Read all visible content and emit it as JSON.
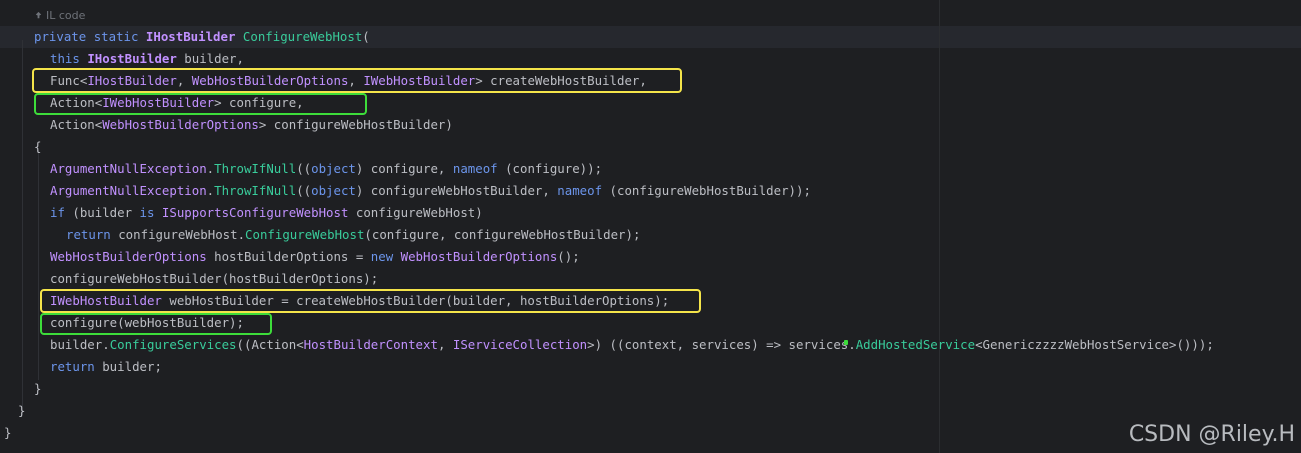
{
  "hint": {
    "label": "IL code",
    "icon": "pin-icon"
  },
  "code_lines": [
    [
      [
        "kw",
        "private"
      ],
      [
        "pn",
        " "
      ],
      [
        "kw",
        "static"
      ],
      [
        "pn",
        " "
      ],
      [
        "tyb",
        "IHostBuilder"
      ],
      [
        "pn",
        " "
      ],
      [
        "fn",
        "ConfigureWebHost"
      ],
      [
        "pn",
        "("
      ]
    ],
    [
      [
        "kw",
        "this"
      ],
      [
        "pn",
        " "
      ],
      [
        "tyb",
        "IHostBuilder"
      ],
      [
        "pn",
        " builder,"
      ]
    ],
    [
      [
        "id",
        "Func<"
      ],
      [
        "ty",
        "IHostBuilder"
      ],
      [
        "pn",
        ", "
      ],
      [
        "ty",
        "WebHostBuilderOptions"
      ],
      [
        "pn",
        ", "
      ],
      [
        "ty",
        "IWebHostBuilder"
      ],
      [
        "pn",
        "> createWebHostBuilder,"
      ]
    ],
    [
      [
        "id",
        "Action<"
      ],
      [
        "ty",
        "IWebHostBuilder"
      ],
      [
        "pn",
        "> configure,"
      ]
    ],
    [
      [
        "id",
        "Action<"
      ],
      [
        "ty",
        "WebHostBuilderOptions"
      ],
      [
        "pn",
        "> configureWebHostBuilder)"
      ]
    ],
    [
      [
        "pn",
        "{"
      ]
    ],
    [
      [
        "ty",
        "ArgumentNullException"
      ],
      [
        "pn",
        "."
      ],
      [
        "fn",
        "ThrowIfNull"
      ],
      [
        "pn",
        "(("
      ],
      [
        "kw",
        "object"
      ],
      [
        "pn",
        ") configure, "
      ],
      [
        "kw",
        "nameof"
      ],
      [
        "pn",
        " (configure));"
      ]
    ],
    [
      [
        "ty",
        "ArgumentNullException"
      ],
      [
        "pn",
        "."
      ],
      [
        "fn",
        "ThrowIfNull"
      ],
      [
        "pn",
        "(("
      ],
      [
        "kw",
        "object"
      ],
      [
        "pn",
        ") configureWebHostBuilder, "
      ],
      [
        "kw",
        "nameof"
      ],
      [
        "pn",
        " (configureWebHostBuilder));"
      ]
    ],
    [
      [
        "kw",
        "if"
      ],
      [
        "pn",
        " (builder "
      ],
      [
        "kw",
        "is"
      ],
      [
        "pn",
        " "
      ],
      [
        "ty",
        "ISupportsConfigureWebHost"
      ],
      [
        "pn",
        " configureWebHost)"
      ]
    ],
    [
      [
        "kw",
        "return"
      ],
      [
        "pn",
        " configureWebHost."
      ],
      [
        "fn",
        "ConfigureWebHost"
      ],
      [
        "pn",
        "(configure, configureWebHostBuilder);"
      ]
    ],
    [
      [
        "ty",
        "WebHostBuilderOptions"
      ],
      [
        "pn",
        " hostBuilderOptions = "
      ],
      [
        "kw",
        "new"
      ],
      [
        "pn",
        " "
      ],
      [
        "ty",
        "WebHostBuilderOptions"
      ],
      [
        "pn",
        "();"
      ]
    ],
    [
      [
        "pn",
        "configureWebHostBuilder(hostBuilderOptions);"
      ]
    ],
    [
      [
        "ty",
        "IWebHostBuilder"
      ],
      [
        "pn",
        " webHostBuilder = createWebHostBuilder(builder, hostBuilderOptions);"
      ]
    ],
    [
      [
        "pn",
        "configure(webHostBuilder);"
      ]
    ],
    [
      [
        "pn",
        "builder."
      ],
      [
        "fn",
        "ConfigureServices"
      ],
      [
        "pn",
        "(("
      ],
      [
        "id",
        "Action<"
      ],
      [
        "ty",
        "HostBuilderContext"
      ],
      [
        "pn",
        ", "
      ],
      [
        "ty",
        "IServiceCollection"
      ],
      [
        "pn",
        ">) ((context, services) => services."
      ],
      [
        "fn",
        "AddHostedService"
      ],
      [
        "pn",
        "<GenericzzzzWebHostService>()));"
      ]
    ],
    [
      [
        "kw",
        "return"
      ],
      [
        "pn",
        " builder;"
      ]
    ],
    [
      [
        "pn",
        "}"
      ]
    ],
    [
      [
        "pn",
        "}"
      ]
    ],
    [
      [
        "pn",
        "}"
      ]
    ]
  ],
  "watermark": "CSDN @Riley.H",
  "colors": {
    "background": "#1e1f22",
    "keyword": "#6c95eb",
    "type": "#c191ff",
    "method": "#39cc9b",
    "text": "#bcbec4",
    "highlight_yellow": "#f4e44a",
    "highlight_green": "#3ddc3a"
  }
}
